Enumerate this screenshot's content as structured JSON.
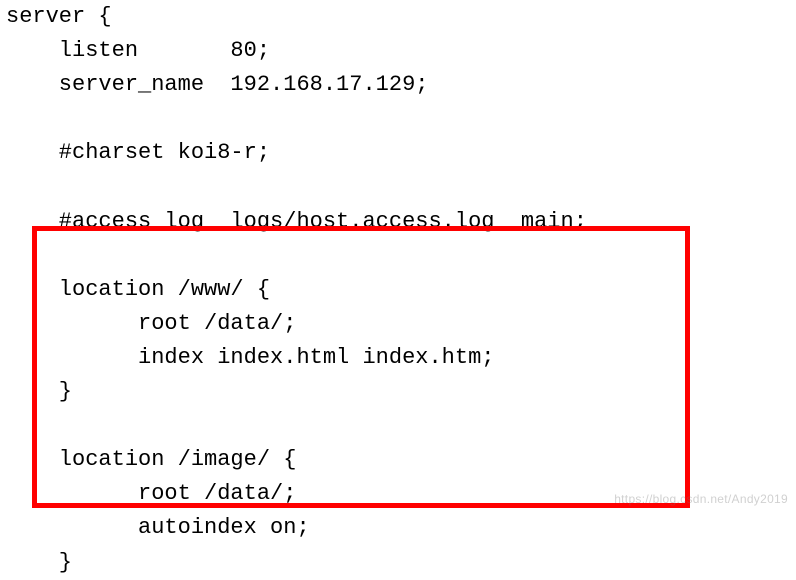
{
  "code": {
    "l1": "server {",
    "l2": "    listen       80;",
    "l3": "    server_name  192.168.17.129;",
    "l4": "",
    "l5": "    #charset koi8-r;",
    "l6": "",
    "l7": "    #access_log  logs/host.access.log  main;",
    "l8": "",
    "l9": "    location /www/ {",
    "l10": "          root /data/;",
    "l11": "          index index.html index.htm;",
    "l12": "    }",
    "l13": "",
    "l14": "    location /image/ {",
    "l15": "          root /data/;",
    "l16": "          autoindex on;",
    "l17": "    }"
  },
  "watermark": "https://blog.csdn.net/Andy2019"
}
